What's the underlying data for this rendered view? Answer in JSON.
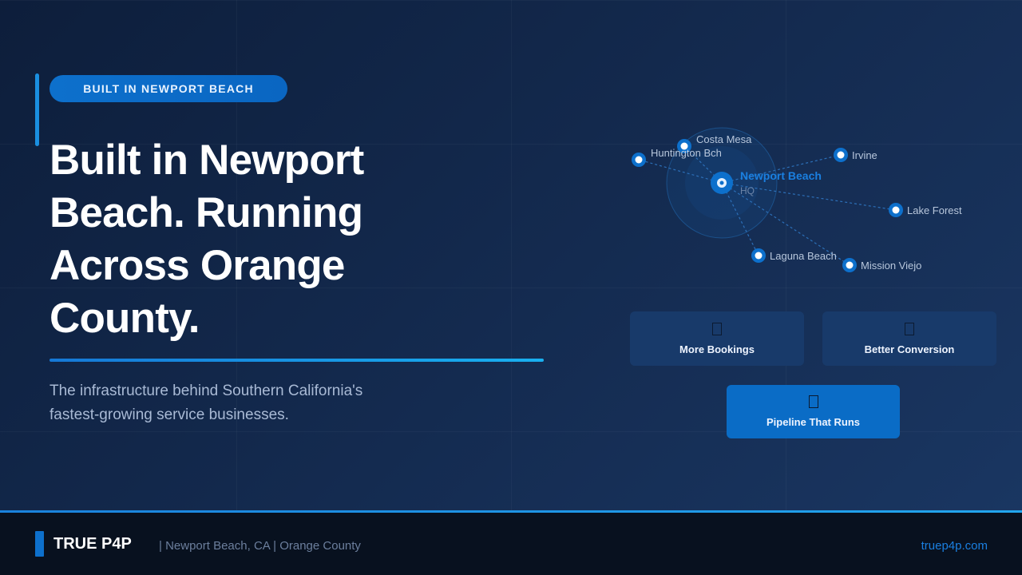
{
  "badge": {
    "label": "BUILT IN NEWPORT BEACH"
  },
  "hero": {
    "headline_lines": [
      "Built in Newport",
      "Beach. Running",
      "Across Orange",
      "County."
    ],
    "subtitle_lines": [
      "The infrastructure behind Southern California's",
      "fastest-growing service businesses."
    ]
  },
  "map": {
    "hq": {
      "name": "Newport Beach",
      "sub": "HQ"
    },
    "cities": [
      {
        "name": "Costa Mesa"
      },
      {
        "name": "Huntington Bch"
      },
      {
        "name": "Irvine"
      },
      {
        "name": "Lake Forest"
      },
      {
        "name": "Laguna Beach"
      },
      {
        "name": "Mission Viejo"
      }
    ]
  },
  "cards": [
    {
      "label": "More Bookings"
    },
    {
      "label": "Better Conversion"
    },
    {
      "label": "Pipeline That Runs"
    }
  ],
  "footer": {
    "brand": "TRUE P4P",
    "location": "| Newport Beach, CA | Orange County",
    "url": "truep4p.com"
  },
  "colors": {
    "accent": "#0a6cc6",
    "accent_light": "#19b0f0",
    "background": "#13294d",
    "footer_bg": "#08111f"
  }
}
